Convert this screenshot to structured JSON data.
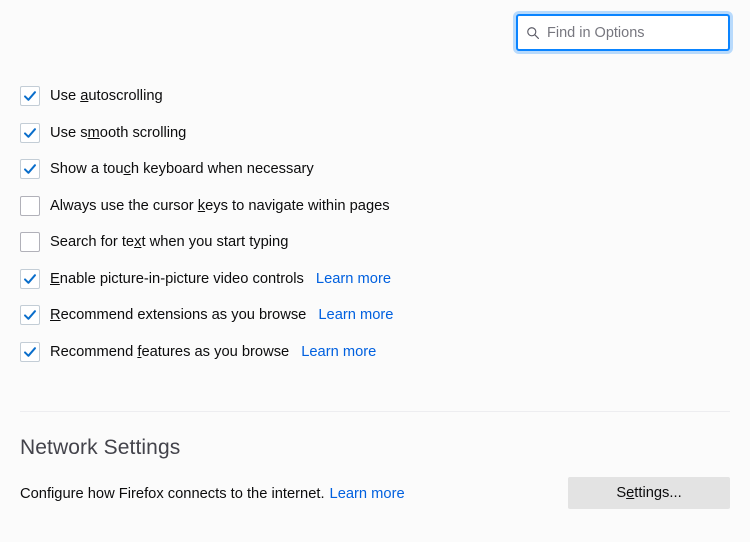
{
  "search": {
    "placeholder": "Find in Options",
    "value": "",
    "icon": "search-icon",
    "focused": true,
    "accent_color": "#0a84ff"
  },
  "options": {
    "items": [
      {
        "label_before": "Use ",
        "accesskey": "a",
        "label_after": "utoscrolling",
        "checked": true,
        "learn_more": ""
      },
      {
        "label_before": "Use s",
        "accesskey": "m",
        "label_after": "ooth scrolling",
        "checked": true,
        "learn_more": ""
      },
      {
        "label_before": "Show a tou",
        "accesskey": "c",
        "label_after": "h keyboard when necessary",
        "checked": true,
        "learn_more": ""
      },
      {
        "label_before": "Always use the cursor ",
        "accesskey": "k",
        "label_after": "eys to navigate within pages",
        "checked": false,
        "learn_more": ""
      },
      {
        "label_before": "Search for te",
        "accesskey": "x",
        "label_after": "t when you start typing",
        "checked": false,
        "learn_more": ""
      },
      {
        "label_before": "",
        "accesskey": "E",
        "label_after": "nable picture-in-picture video controls",
        "checked": true,
        "learn_more": "Learn more"
      },
      {
        "label_before": "",
        "accesskey": "R",
        "label_after": "ecommend extensions as you browse",
        "checked": true,
        "learn_more": "Learn more"
      },
      {
        "label_before": "Recommend ",
        "accesskey": "f",
        "label_after": "eatures as you browse",
        "checked": true,
        "learn_more": "Learn more"
      }
    ]
  },
  "network": {
    "title": "Network Settings",
    "description": "Configure how Firefox connects to the internet.",
    "learn_more": "Learn more",
    "button_before": "S",
    "button_accesskey": "e",
    "button_after": "ttings..."
  },
  "colors": {
    "page_background": "#fbfbfb",
    "link": "#0060df",
    "checkmark": "#0a6ecb",
    "focus_ring": "#0a84ff",
    "divider": "#ededf0",
    "button_background": "#e3e3e3"
  }
}
